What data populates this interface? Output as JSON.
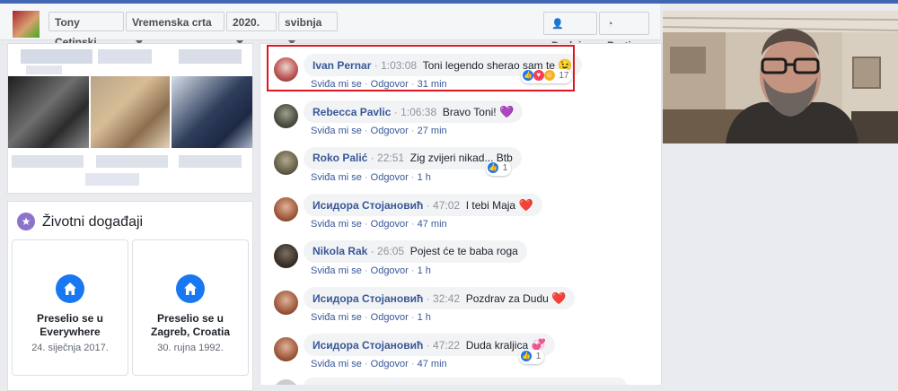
{
  "header": {
    "crumbs": [
      "Tony Cetinski",
      "Vremenska crta",
      "2020.",
      "svibnja"
    ],
    "add_button": "Dodaj",
    "follow_button": "Prati"
  },
  "life_events": {
    "title": "Životni događaji",
    "cards": [
      {
        "title_line1": "Preselio se u",
        "title_line2": "Everywhere",
        "date": "24. siječnja 2017."
      },
      {
        "title_line1": "Preselio se u",
        "title_line2": "Zagreb, Croatia",
        "date": "30. rujna 1992."
      }
    ]
  },
  "actions": {
    "like": "Sviđa mi se",
    "reply": "Odgovor"
  },
  "comments": [
    {
      "name": "Ivan Pernar",
      "time": "1:03:08",
      "text": "Toni legendo sherao sam te",
      "emoji": "😉",
      "age": "31 min",
      "reactions": "17"
    },
    {
      "name": "Rebecca Pavlic",
      "time": "1:06:38",
      "text": "Bravo Toni!",
      "emoji": "💜",
      "age": "27 min",
      "reactions": ""
    },
    {
      "name": "Roko Palić",
      "time": "22:51",
      "text": "Zig zvijeri nikad... Btb",
      "emoji": "",
      "age": "1 h",
      "reactions": "1"
    },
    {
      "name": "Исидора Стојановић",
      "time": "47:02",
      "text": "I tebi Maja",
      "emoji": "❤️",
      "age": "47 min",
      "reactions": ""
    },
    {
      "name": "Nikola Rak",
      "time": "26:05",
      "text": "Pojest će te baba roga",
      "emoji": "",
      "age": "1 h",
      "reactions": ""
    },
    {
      "name": "Исидора Стојановић",
      "time": "32:42",
      "text": "Pozdrav za Dudu",
      "emoji": "❤️",
      "age": "1 h",
      "reactions": ""
    },
    {
      "name": "Исидора Стојановић",
      "time": "47:22",
      "text": "Duda kraljica",
      "emoji": "💞",
      "age": "47 min",
      "reactions": "1"
    }
  ],
  "colors": {
    "accent": "#4267b2",
    "link": "#385898",
    "highlight": "#e0141e",
    "like": "#1877f2"
  },
  "icons": [
    "add-friend-icon",
    "rss-icon",
    "star-icon",
    "home-icon",
    "like-reaction-icon",
    "love-reaction-icon",
    "haha-reaction-icon"
  ]
}
